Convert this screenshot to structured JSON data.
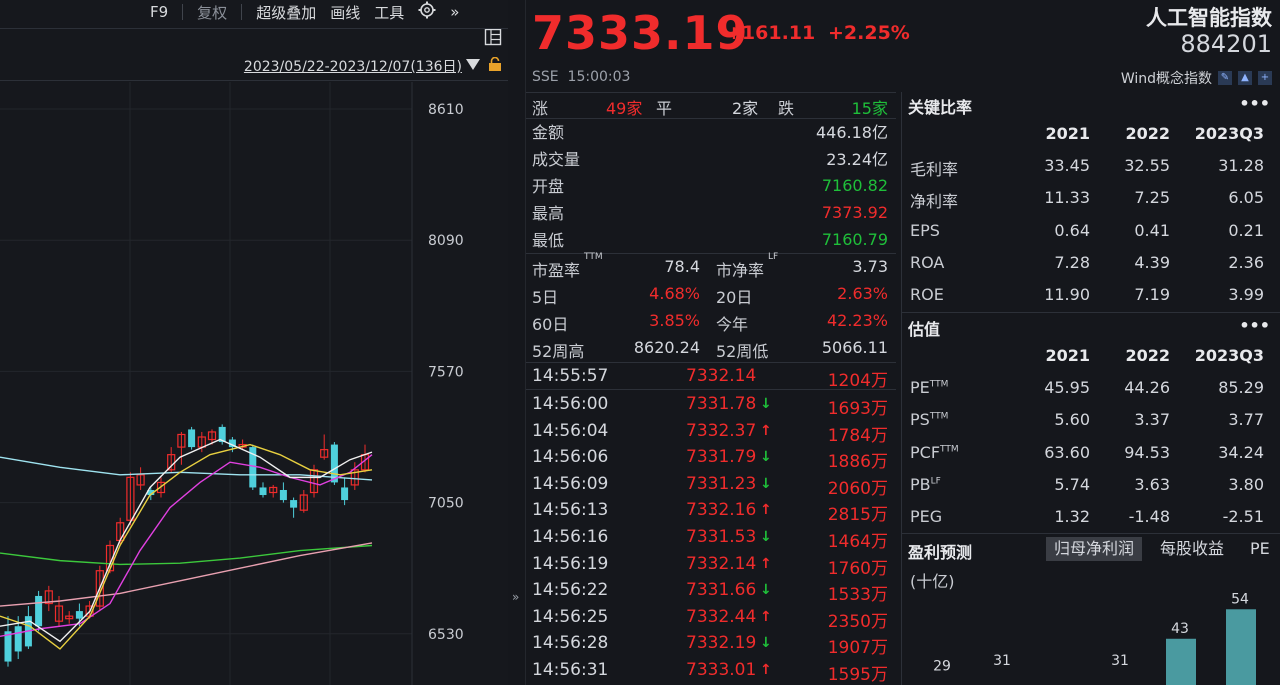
{
  "toolbar": {
    "items": [
      "F9",
      "复权",
      "超级叠加",
      "画线",
      "工具"
    ],
    "more": "»",
    "range": "2023/05/22-2023/12/07(136日)"
  },
  "chart": {
    "y_ticks": [
      "8610",
      "8090",
      "7570",
      "7050",
      "6530"
    ]
  },
  "header": {
    "price": "7333.19",
    "change": "+161.11",
    "change_pct": "+2.25%",
    "exchange": "SSE",
    "time": "15:00:03",
    "index_name": "人工智能指数",
    "index_code": "884201",
    "category": "Wind概念指数"
  },
  "breadth": {
    "up_label": "涨",
    "up_count": "49家",
    "flat_label": "平",
    "flat_count": "2家",
    "down_label": "跌",
    "down_count": "15家"
  },
  "quote": [
    {
      "label": "金额",
      "value": "446.18亿",
      "color": "wh"
    },
    {
      "label": "成交量",
      "value": "23.24亿",
      "color": "wh"
    },
    {
      "label": "开盘",
      "value": "7160.82",
      "color": "dn"
    },
    {
      "label": "最高",
      "value": "7373.92",
      "color": "up"
    },
    {
      "label": "最低",
      "value": "7160.79",
      "color": "dn"
    }
  ],
  "metrics": [
    {
      "l1": "市盈率",
      "s1": "TTM",
      "v1": "78.4",
      "c1": "wh",
      "l2": "市净率",
      "s2": "LF",
      "v2": "3.73",
      "c2": "wh"
    },
    {
      "l1": "5日",
      "s1": "",
      "v1": "4.68%",
      "c1": "up",
      "l2": "20日",
      "s2": "",
      "v2": "2.63%",
      "c2": "up"
    },
    {
      "l1": "60日",
      "s1": "",
      "v1": "3.85%",
      "c1": "up",
      "l2": "今年",
      "s2": "",
      "v2": "42.23%",
      "c2": "up"
    },
    {
      "l1": "52周高",
      "s1": "",
      "v1": "8620.24",
      "c1": "wh",
      "l2": "52周低",
      "s2": "",
      "v2": "5066.11",
      "c2": "wh"
    }
  ],
  "ticks": [
    {
      "time": "14:55:57",
      "price": "7332.14",
      "dir": "",
      "vol": "1204万"
    },
    {
      "time": "14:56:00",
      "price": "7331.78",
      "dir": "down",
      "vol": "1693万"
    },
    {
      "time": "14:56:04",
      "price": "7332.37",
      "dir": "up",
      "vol": "1784万"
    },
    {
      "time": "14:56:06",
      "price": "7331.79",
      "dir": "down",
      "vol": "1886万"
    },
    {
      "time": "14:56:09",
      "price": "7331.23",
      "dir": "down",
      "vol": "2060万"
    },
    {
      "time": "14:56:13",
      "price": "7332.16",
      "dir": "up",
      "vol": "2815万"
    },
    {
      "time": "14:56:16",
      "price": "7331.53",
      "dir": "down",
      "vol": "1464万"
    },
    {
      "time": "14:56:19",
      "price": "7332.14",
      "dir": "up",
      "vol": "1760万"
    },
    {
      "time": "14:56:22",
      "price": "7331.66",
      "dir": "down",
      "vol": "1533万"
    },
    {
      "time": "14:56:25",
      "price": "7332.44",
      "dir": "up",
      "vol": "2350万"
    },
    {
      "time": "14:56:28",
      "price": "7332.19",
      "dir": "down",
      "vol": "1907万"
    },
    {
      "time": "14:56:31",
      "price": "7333.01",
      "dir": "up",
      "vol": "1595万"
    }
  ],
  "key_ratios": {
    "title": "关键比率",
    "more": "•••",
    "years": [
      "2021",
      "2022",
      "2023Q3"
    ],
    "rows": [
      {
        "label": "毛利率",
        "sup": "",
        "values": [
          "33.45",
          "32.55",
          "31.28"
        ]
      },
      {
        "label": "净利率",
        "sup": "",
        "values": [
          "11.33",
          "7.25",
          "6.05"
        ]
      },
      {
        "label": "EPS",
        "sup": "",
        "values": [
          "0.64",
          "0.41",
          "0.21"
        ]
      },
      {
        "label": "ROA",
        "sup": "",
        "values": [
          "7.28",
          "4.39",
          "2.36"
        ]
      },
      {
        "label": "ROE",
        "sup": "",
        "values": [
          "11.90",
          "7.19",
          "3.99"
        ]
      }
    ]
  },
  "valuation": {
    "title": "估值",
    "more": "•••",
    "years": [
      "2021",
      "2022",
      "2023Q3"
    ],
    "rows": [
      {
        "label": "PE",
        "sup": "TTM",
        "values": [
          "45.95",
          "44.26",
          "85.29"
        ]
      },
      {
        "label": "PS",
        "sup": "TTM",
        "values": [
          "5.60",
          "3.37",
          "3.77"
        ]
      },
      {
        "label": "PCF",
        "sup": "TTM",
        "values": [
          "63.60",
          "94.53",
          "34.24"
        ]
      },
      {
        "label": "PB",
        "sup": "LF",
        "values": [
          "5.74",
          "3.63",
          "3.80"
        ]
      },
      {
        "label": "PEG",
        "sup": "",
        "values": [
          "1.32",
          "-1.48",
          "-2.51"
        ]
      }
    ]
  },
  "forecast": {
    "title": "盈利预测",
    "tabs": [
      "归母净利润",
      "每股收益",
      "PE"
    ],
    "unit": "(十亿)",
    "bar_labels": [
      "29",
      "31",
      "31",
      "43",
      "54"
    ]
  },
  "colors": {
    "up": "#f02c2c",
    "down": "#1fbf3a",
    "cyan": "#4fd0dc"
  }
}
